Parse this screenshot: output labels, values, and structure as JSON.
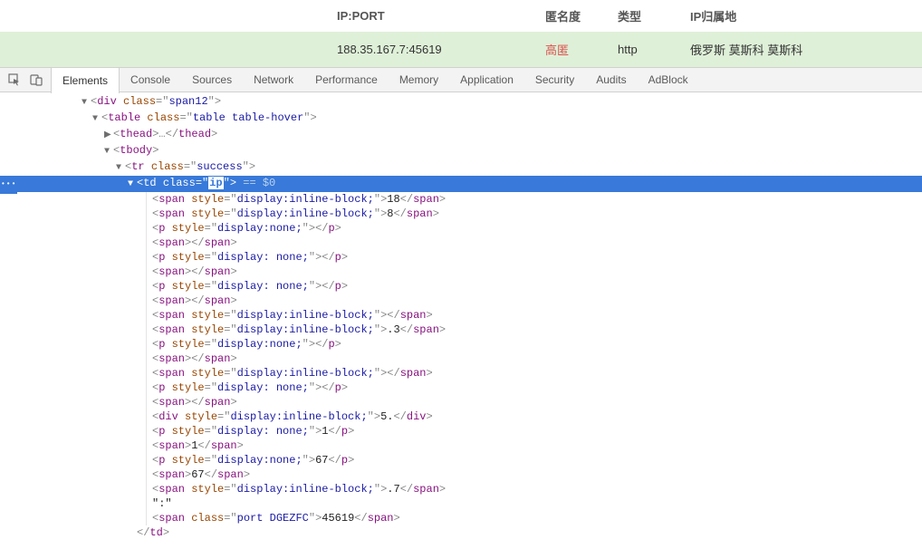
{
  "table": {
    "headers": {
      "ipport": "IP:PORT",
      "anon": "匿名度",
      "type": "类型",
      "loc": "IP归属地"
    },
    "row": {
      "ipport": "188.35.167.7:45619",
      "anon": "高匿",
      "type": "http",
      "loc": "俄罗斯  莫斯科  莫斯科"
    }
  },
  "devtools": {
    "tabs": {
      "elements": "Elements",
      "console": "Console",
      "sources": "Sources",
      "network": "Network",
      "performance": "Performance",
      "memory": "Memory",
      "application": "Application",
      "security": "Security",
      "audits": "Audits",
      "adblock": "AdBlock"
    }
  },
  "dom": {
    "div_open": "<div class=\"span12\">",
    "table_open": "<table class=\"table table-hover\">",
    "thead": "<thead>…</thead>",
    "tbody_open": "<tbody>",
    "tr_open": "<tr class=\"success\">",
    "sel_eq": " == $0",
    "lines": [
      "<span style=\"display:inline-block;\">18</span>",
      "<span style=\"display:inline-block;\">8</span>",
      "<p style=\"display:none;\"></p>",
      "<span></span>",
      "<p style=\"display: none;\"></p>",
      "<span></span>",
      "<p style=\"display: none;\"></p>",
      "<span></span>",
      "<span style=\"display:inline-block;\"></span>",
      "<span style=\"display:inline-block;\">.3</span>",
      "<p style=\"display:none;\"></p>",
      "<span></span>",
      "<span style=\"display:inline-block;\"></span>",
      "<p style=\"display: none;\"></p>",
      "<span></span>",
      "<div style=\"display:inline-block;\">5.</div>",
      "<p style=\"display: none;\">1</p>",
      "<span>1</span>",
      "<p style=\"display:none;\">67</p>",
      "<span>67</span>",
      "<span style=\"display:inline-block;\">.7</span>",
      "\":\"",
      "<span class=\"port DGEZFC\">45619</span>"
    ],
    "td_close": "</td>"
  }
}
